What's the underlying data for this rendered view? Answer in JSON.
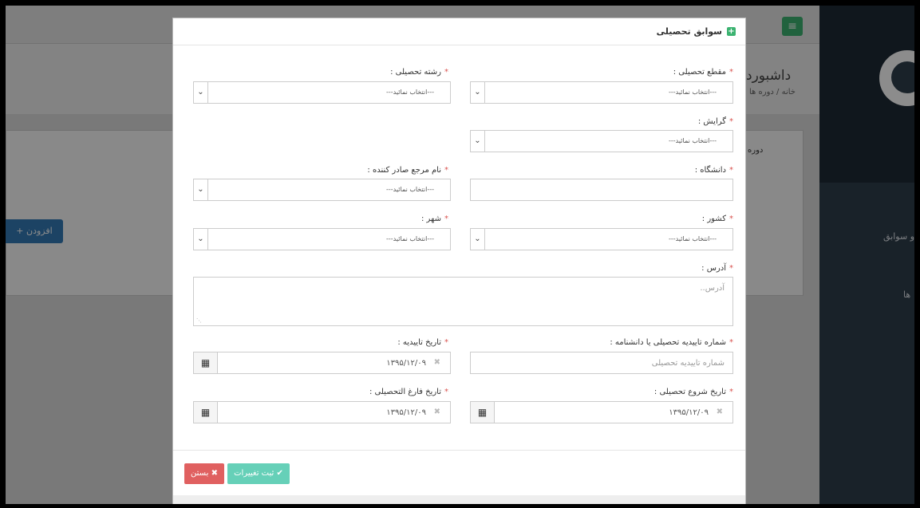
{
  "background": {
    "dashboard_title": "داشبورد",
    "breadcrumb": [
      "خانه",
      "دوره ها"
    ],
    "panel_heading": "دوره",
    "add_button": "افزودن",
    "sidebar_items": [
      "و سوابق",
      "ها"
    ]
  },
  "modal": {
    "title": "سوابق تحصیلی",
    "fields": {
      "grade": {
        "label": "مقطع تحصیلی :",
        "value": "---انتخاب نمائید---"
      },
      "major": {
        "label": "رشته تحصیلی :",
        "value": "---انتخاب نمائید---"
      },
      "orientation": {
        "label": "گرایش :",
        "value": "---انتخاب نمائید---"
      },
      "university": {
        "label": "دانشگاه :",
        "value": ""
      },
      "issuer": {
        "label": "نام مرجع صادر کننده :",
        "value": "---انتخاب نمائید---"
      },
      "country": {
        "label": "کشور :",
        "value": "---انتخاب نمائید---"
      },
      "city": {
        "label": "شهر :",
        "value": "---انتخاب نمائید---"
      },
      "address": {
        "label": "آدرس :",
        "placeholder": "آدرس.."
      },
      "confirm_no": {
        "label": "شماره تاییدیه تحصیلی یا دانشنامه :",
        "placeholder": "شماره تاییدیه تحصیلی"
      },
      "confirm_date": {
        "label": "تاریخ تاییدیه :",
        "value": "۱۳۹۵/۱۲/۰۹"
      },
      "start_date": {
        "label": "تاریخ شروع تحصیلی :",
        "value": "۱۳۹۵/۱۲/۰۹"
      },
      "grad_date": {
        "label": "تاریخ فارغ التحصیلی :",
        "value": "۱۳۹۵/۱۲/۰۹"
      }
    },
    "buttons": {
      "save": "ثبت تغییرات",
      "close": "بستن"
    }
  },
  "icons": {
    "required": "*",
    "calendar": "calendar-icon",
    "clear": "clear-x-icon",
    "caret": "chevron-down-icon"
  }
}
